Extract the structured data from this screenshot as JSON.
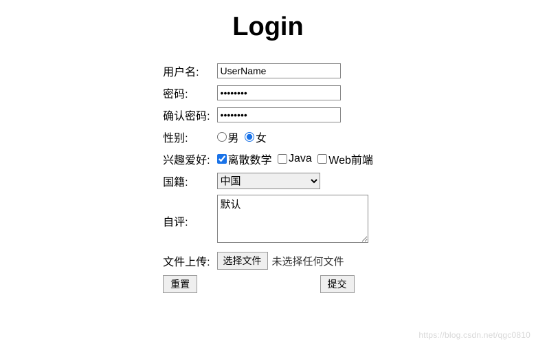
{
  "title": "Login",
  "labels": {
    "username": "用户名:",
    "password": "密码:",
    "confirm": "确认密码:",
    "gender": "性别:",
    "hobby": "兴趣爱好:",
    "nation": "国籍:",
    "selfEval": "自评:",
    "upload": "文件上传:"
  },
  "fields": {
    "username_value": "UserName",
    "password_value": "••••••••",
    "confirm_value": "••••••••",
    "gender_male": "男",
    "gender_female": "女",
    "hobby_discrete": "离散数学",
    "hobby_java": "Java",
    "hobby_web": "Web前端",
    "nation_selected": "中国",
    "selfEval_value": "默认",
    "file_button": "选择文件",
    "file_status": "未选择任何文件"
  },
  "buttons": {
    "reset": "重置",
    "submit": "提交"
  },
  "watermark": "https://blog.csdn.net/qgc0810"
}
